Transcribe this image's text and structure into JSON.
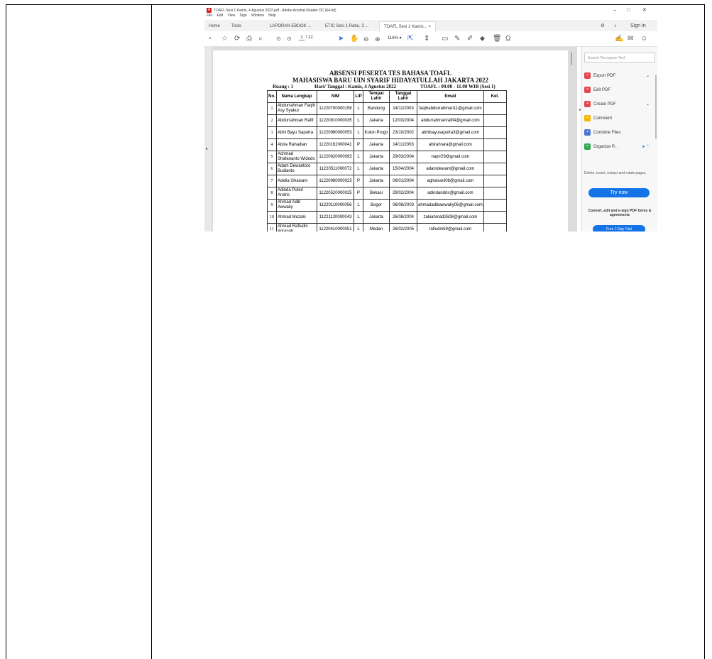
{
  "window": {
    "title": "TOAFL Sesi 1 Kamis, 4 Agustus 2022.pdf - Adobe Acrobat Reader DC (64-bit)",
    "controls": [
      "–",
      "□",
      "✕"
    ]
  },
  "menu": [
    "File",
    "Edit",
    "View",
    "Sign",
    "Window",
    "Help"
  ],
  "tabs": {
    "home": "Home",
    "tools": "Tools",
    "doc1": "LAPORAN EBOOK ...",
    "doc2": "ETIC Sesi 1 Rabu, 3 ...",
    "doc3": "TOAFL Sesi 1 Kamis... ×",
    "sign_in": "Sign In"
  },
  "toolbar": {
    "page_current": "1",
    "page_total": "/ 12",
    "zoom": "116%"
  },
  "document": {
    "title_line1": "ABSENSI PESERTA TES BAHASA TOAFL",
    "title_line2": "MAHASISWA BARU UIN SYARIF HIDAYATULLAH JAKARTA 2022",
    "room": "Ruang : 1",
    "date": "Hari/ Tanggal : Kamis, 4 Agustus 2022",
    "session": "TOAFL : 09.00 - 11.00 WIB (Sesi 1)",
    "columns": [
      "No.",
      "Nama Lengkap",
      "NIM",
      "L/P",
      "Tempat Lahir",
      "Tanggal Lahir",
      "Email",
      "Ket."
    ],
    "rows": [
      {
        "no": "1",
        "name": "Abdurrahman Faqih Asy Syakur",
        "nim": "11220700000158",
        "lp": "L",
        "place": "Bandung",
        "dob": "14/11/2003",
        "email": "faqihabdurrahman11@gmail.com",
        "ket": ""
      },
      {
        "no": "2",
        "name": "Abdurrahman Rafif",
        "nim": "11220910000035",
        "lp": "L",
        "place": "Jakarta",
        "dob": "12/03/2004",
        "email": "abdurrahmanrafif4@gmail.com",
        "ket": ""
      },
      {
        "no": "3",
        "name": "Abhi Bayu Saputra",
        "nim": "11220960000053",
        "lp": "L",
        "place": "Kulon Progo",
        "dob": "23/10/2002",
        "email": "abhibayusaputra3@gmail.com",
        "ket": ""
      },
      {
        "no": "4",
        "name": "Abira Rahadian",
        "nim": "11220162000041",
        "lp": "P",
        "place": "Jakarta",
        "dob": "14/11/2003",
        "email": "abirahrara@gmail.com",
        "ket": ""
      },
      {
        "no": "5",
        "name": "Achmad Shafananto Widodo",
        "nim": "11220820000093",
        "lp": "L",
        "place": "Jakarta",
        "dob": "29/03/2004",
        "email": "nayrr29@gmail.com",
        "ket": ""
      },
      {
        "no": "6",
        "name": "Adam Dewantoro Budianto",
        "nim": "11220511000072",
        "lp": "L",
        "place": "Jakarta",
        "dob": "15/04/2004",
        "email": "adamdewant@gmail.com",
        "ket": ""
      },
      {
        "no": "7",
        "name": "Adelia Ghaisani",
        "nim": "11220980000023",
        "lp": "P",
        "place": "Jakarta",
        "dob": "08/01/2004",
        "email": "aghaisani08@gmail.com",
        "ket": ""
      },
      {
        "no": "8",
        "name": "Adinda Puteri Andris",
        "nim": "11220520000025",
        "lp": "P",
        "place": "Bekasi",
        "dob": "29/02/2004",
        "email": "adindandris@gmail.com",
        "ket": ""
      },
      {
        "no": "9",
        "name": "Ahmad Adib Awwaliy",
        "nim": "11220110000056",
        "lp": "L",
        "place": "Bogor",
        "dob": "06/08/2003",
        "email": "ahmadadibawwaliy06@gmail.com",
        "ket": ""
      },
      {
        "no": "10",
        "name": "Ahmad Muzaki",
        "nim": "11221120000043",
        "lp": "L",
        "place": "Jakarta",
        "dob": "26/08/2004",
        "email": "zakiahmad2608@gmail.com",
        "ket": ""
      },
      {
        "no": "11",
        "name": "Ahmad Rafiudin Arkanah",
        "nim": "11220410000051",
        "lp": "L",
        "place": "Medan",
        "dob": "26/02/2005",
        "email": "rafiudin59@gmail.com",
        "ket": ""
      }
    ]
  },
  "panel": {
    "search_placeholder": "Search 'Recognize Text'",
    "items": [
      {
        "label": "Export PDF",
        "color": "#e34850",
        "icon": "export-pdf-icon"
      },
      {
        "label": "Edit PDF",
        "color": "#e34850",
        "icon": "edit-pdf-icon"
      },
      {
        "label": "Create PDF",
        "color": "#e34850",
        "icon": "create-pdf-icon"
      },
      {
        "label": "Comment",
        "color": "#f2b600",
        "icon": "comment-icon"
      },
      {
        "label": "Combine Files",
        "color": "#4b75d4",
        "icon": "combine-files-icon"
      },
      {
        "label": "Organize P...",
        "color": "#34a853",
        "icon": "organize-pages-icon"
      }
    ],
    "organize_desc": "Delete, insert, extract and rotate pages.",
    "try_now": "Try now",
    "promo": "Convert, edit and e-sign PDF forms & agreements",
    "free_trial": "Free 7-Day Trial"
  }
}
